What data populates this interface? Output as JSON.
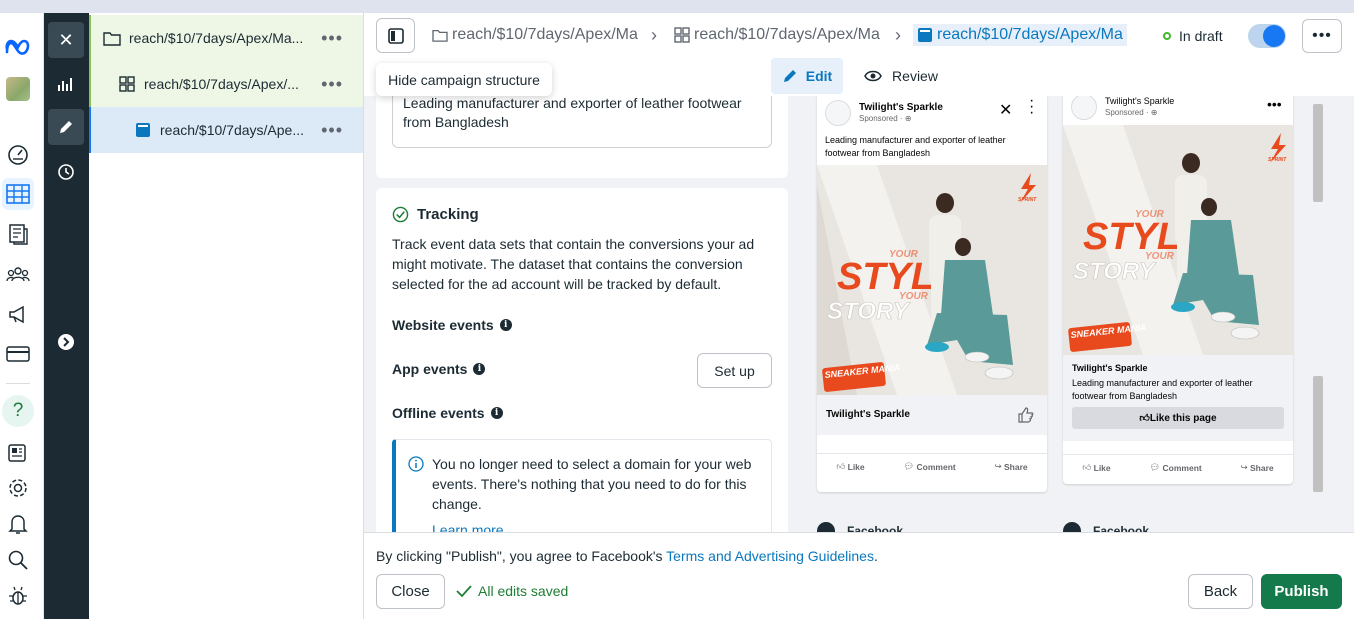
{
  "leftnav": {
    "icons": [
      "meta-logo-icon",
      "profile-thumbnail",
      "dashboard-icon",
      "table-icon",
      "pages-icon",
      "audience-icon",
      "megaphone-icon",
      "billing-icon",
      "help-icon",
      "news-icon",
      "settings-icon",
      "notifications-icon",
      "search-icon",
      "bug-icon"
    ],
    "help_symbol": "?"
  },
  "toolbar": {
    "close_symbol": "✕"
  },
  "structure": {
    "campaign": "reach/$10/7days/Apex/Ma...",
    "adset": "reach/$10/7days/Apex/...",
    "ad": "reach/$10/7days/Ape...",
    "more_symbol": "•••"
  },
  "header": {
    "crumb_campaign": "reach/$10/7days/Apex/Ma",
    "crumb_adset": "reach/$10/7days/Apex/Ma",
    "crumb_ad": "reach/$10/7days/Apex/Ma",
    "status": "In draft",
    "more_symbol": "•••"
  },
  "tooltip": "Hide campaign structure",
  "tabs": {
    "edit": "Edit",
    "review": "Review"
  },
  "editor": {
    "primary_text": "Leading manufacturer and exporter of leather footwear from Bangladesh",
    "tracking": {
      "title": "Tracking",
      "description": "Track event data sets that contain the conversions your ad might motivate. The dataset that contains the conversion selected for the ad account will be tracked by default.",
      "website_events": "Website events",
      "app_events": "App events",
      "setup_label": "Set up",
      "offline_events": "Offline events",
      "notice": "You no longer need to select a domain for your web events. There's nothing that you need to do for this change.",
      "learn_more": "Learn more"
    }
  },
  "preview": {
    "page_name": "Twilight's Sparkle",
    "sponsored": "Sponsored · ⊕",
    "ad_text": "Leading manufacturer and exporter of leather footwear from Bangladesh",
    "headline": "Twilight's Sparkle",
    "like_page": "Like this page",
    "like": "Like",
    "comment": "Comment",
    "share": "Share",
    "platform_label": "Facebook",
    "image": {
      "your1": "YOUR",
      "style": "STYLE",
      "your2": "YOUR",
      "story": "STORY",
      "brand": "SNEAKER MANIA",
      "logo": "SPRINT"
    },
    "colors": {
      "accent": "#e8491d",
      "image_bg": "#e9e6e1",
      "outfit": "#5a9a98"
    }
  },
  "footer": {
    "terms_prefix": "By clicking \"Publish\", you agree to Facebook's ",
    "terms_link": "Terms and Advertising Guidelines",
    "terms_suffix": ".",
    "close": "Close",
    "saved": "All edits saved",
    "back": "Back",
    "publish": "Publish"
  },
  "colors": {
    "brand_blue": "#0a78be",
    "publish_green": "#147a4b",
    "dark_bar": "#1c2b33"
  }
}
